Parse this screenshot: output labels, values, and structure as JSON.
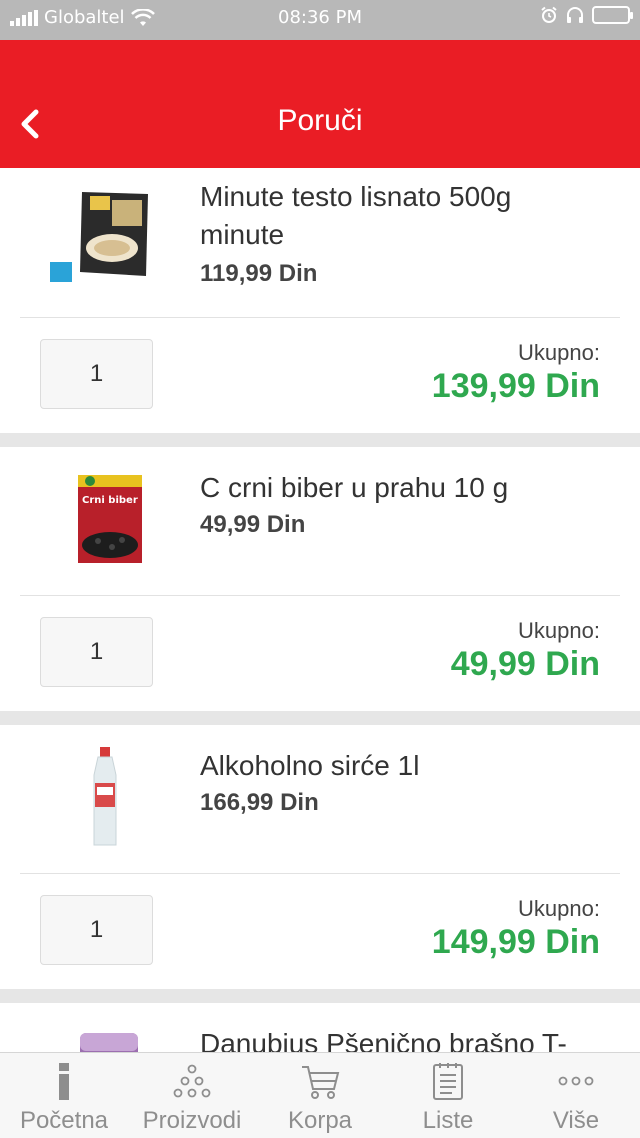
{
  "status_bar": {
    "carrier": "Globaltel",
    "time": "08:36 PM"
  },
  "header": {
    "title": "Poruči"
  },
  "products": [
    {
      "name": "Minute testo lisnato 500g minute",
      "price": "119,99 Din",
      "quantity": "1",
      "total_label": "Ukupno:",
      "total": "139,99 Din"
    },
    {
      "name": "C crni biber u prahu 10 g",
      "price": "49,99 Din",
      "quantity": "1",
      "total_label": "Ukupno:",
      "total": "49,99 Din"
    },
    {
      "name": "Alkoholno sirće 1l",
      "price": "166,99 Din",
      "quantity": "1",
      "total_label": "Ukupno:",
      "total": "149,99 Din"
    },
    {
      "name": "Danubius Pšenično brašno T-"
    }
  ],
  "tabbar": {
    "items": [
      {
        "label": "Početna",
        "icon": "info-icon"
      },
      {
        "label": "Proizvodi",
        "icon": "dots-triangle-icon"
      },
      {
        "label": "Korpa",
        "icon": "cart-icon"
      },
      {
        "label": "Liste",
        "icon": "list-icon"
      },
      {
        "label": "Više",
        "icon": "more-icon"
      }
    ]
  },
  "colors": {
    "brand_red": "#ea1d25",
    "total_green": "#2fa84f",
    "status_bar": "#b8b8b8"
  }
}
